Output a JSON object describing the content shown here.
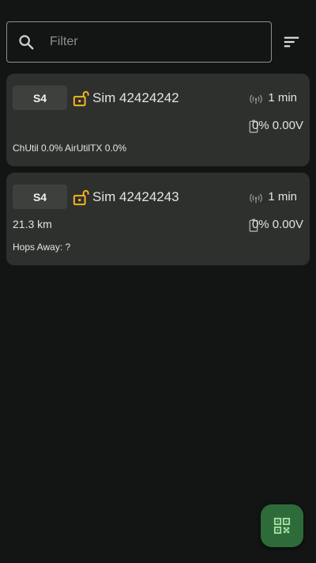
{
  "search": {
    "placeholder": "Filter"
  },
  "nodes": [
    {
      "short_name": "S4",
      "long_name": "Sim 42424242",
      "last_heard": "1 min",
      "battery": "0% 0.00V",
      "distance": "",
      "info_line": "ChUtil 0.0% AirUtilTX 0.0%"
    },
    {
      "short_name": "S4",
      "long_name": "Sim 42424243",
      "last_heard": "1 min",
      "battery": "0% 0.00V",
      "distance": "21.3 km",
      "info_line": "Hops Away: ?"
    }
  ],
  "colors": {
    "background": "#121513",
    "card": "#2e302e",
    "lock": "#f2b51f",
    "fab": "#2e6b3a",
    "fab_icon": "#a6e3a8"
  },
  "icons": [
    "search-icon",
    "sort-icon",
    "unlocked-icon",
    "signal-icon",
    "battery-icon",
    "qr-code-scanner-icon"
  ]
}
